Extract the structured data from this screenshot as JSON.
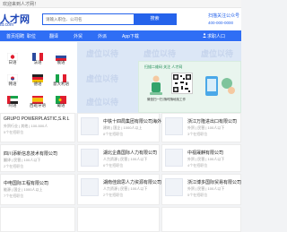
{
  "topbar": {
    "welcome": "欢迎来到人才网！"
  },
  "header": {
    "logo_main": "人才网",
    "logo_sub": "ttt.com",
    "search_placeholder": "请输入职位、公司名",
    "search_button": "搜索",
    "hotline_line1": "扫描关注公众号",
    "hotline_line2": "400-000-0000"
  },
  "nav": {
    "items": [
      "首页招聘",
      "职位",
      "翻译",
      "外贸",
      "外派",
      "App下载"
    ],
    "badge": "",
    "user": "求职人口"
  },
  "countries": [
    {
      "label": "日语",
      "color": "#ffffff",
      "accent": "#e11d2e"
    },
    {
      "label": "法语",
      "color": "#2c4a9e",
      "accent": "#e11d2e"
    },
    {
      "label": "俄语",
      "color": "#ffffff",
      "accent": "#2c4a9e"
    },
    {
      "label": "韩语",
      "color": "#ffffff",
      "accent": "#2c4a9e"
    },
    {
      "label": "德语",
      "color": "#222222",
      "accent": "#f2c200"
    },
    {
      "label": "意大利语",
      "color": "#17a34a",
      "accent": "#e11d2e"
    },
    {
      "label": "阿语",
      "color": "#17a34a",
      "accent": "#222222"
    },
    {
      "label": "西班牙语",
      "color": "#e11d2e",
      "accent": "#f2c200"
    },
    {
      "label": "葡语",
      "color": "#17a34a",
      "accent": "#e11d2e"
    }
  ],
  "banner": {
    "ghost_text": "虚位以待",
    "promo_heading": "扫描二维码 关注 人才网",
    "promo_caption": "微信扫一扫 随时随地找工作"
  },
  "companies": [
    {
      "name": "GRUPO POWERPLASTIC,S.R.L",
      "sub": "外贸行业 | 其他 | 100-500人",
      "sub2": "5个在招职位"
    },
    {
      "name": "中铁十四局集团有限公司海外工程...",
      "sub": "建筑 | 国企 | 1000人以上",
      "sub2": "8个在招职位"
    },
    {
      "name": "浙江万隆进出口有限公司",
      "sub": "外贸 | 民营 | 100人以下",
      "sub2": "3个在招职位"
    },
    {
      "name": "四川添新信息技术有限公司",
      "sub": "翻译 | 民营 | 100人以下",
      "sub2": "2个在招职位"
    },
    {
      "name": "湖北企鑫国际人力有限公司",
      "sub": "人力资源 | 民营 | 100人以下",
      "sub2": "6个在招职位"
    },
    {
      "name": "中视晟麒有限公司",
      "sub": "外贸 | 民营 | 100人以下",
      "sub2": "4个在招职位"
    },
    {
      "name": "中电国际工程有限公司",
      "sub": "能源 | 国企 | 1000人以上",
      "sub2": "7个在招职位"
    },
    {
      "name": "湖南佳鼎思人力资源有限公司",
      "sub": "人力资源 | 民营 | 100人以下",
      "sub2": "2个在招职位"
    },
    {
      "name": "浙江博多国际贸易有限公司",
      "sub": "外贸 | 民营 | 100人以下",
      "sub2": "5个在招职位"
    }
  ]
}
